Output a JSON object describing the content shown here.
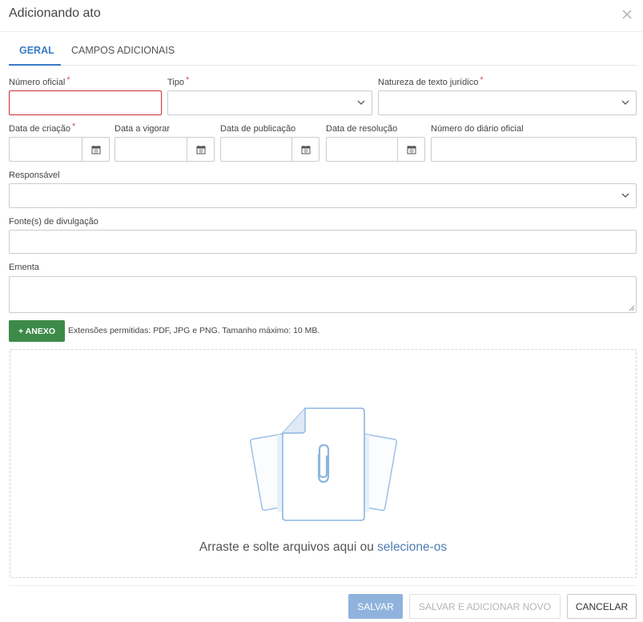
{
  "dialog": {
    "title": "Adicionando ato"
  },
  "tabs": [
    {
      "label": "GERAL"
    },
    {
      "label": "CAMPOS ADICIONAIS"
    }
  ],
  "form": {
    "numero_oficial": {
      "label": "Número oficial",
      "required_mark": "*",
      "value": ""
    },
    "tipo": {
      "label": "Tipo",
      "required_mark": "*",
      "value": ""
    },
    "natureza": {
      "label": "Natureza de texto jurídico",
      "required_mark": "*",
      "value": ""
    },
    "data_criacao": {
      "label": "Data de criação",
      "required_mark": "*",
      "value": ""
    },
    "data_vigorar": {
      "label": "Data a vigorar",
      "value": ""
    },
    "data_publicacao": {
      "label": "Data de publicação",
      "value": ""
    },
    "data_resolucao": {
      "label": "Data de resolução",
      "value": ""
    },
    "numero_diario": {
      "label": "Número do diário oficial",
      "value": ""
    },
    "responsavel": {
      "label": "Responsável",
      "value": ""
    },
    "fontes": {
      "label": "Fonte(s) de divulgação",
      "value": ""
    },
    "ementa": {
      "label": "Ementa",
      "value": ""
    }
  },
  "attachments": {
    "button_label": "+ ANEXO",
    "extensions_text": "Extensões permitidas: PDF, JPG e PNG. Tamanho máximo: 10 MB.",
    "drop_text": "Arraste e solte arquivos aqui ou",
    "select_link": "selecione-os"
  },
  "footer": {
    "save_label": "SALVAR",
    "save_new_label": "SALVAR E ADICIONAR NOVO",
    "cancel_label": "CANCELAR"
  },
  "icons": {
    "close": "close-icon",
    "dropdown": "chevron-down-icon",
    "calendar": "calendar-icon",
    "files": "documents-illustration",
    "clip": "paperclip-icon"
  },
  "colors": {
    "accent": "#3a7bc8",
    "required": "#d9534f",
    "error_border": "#c9302c",
    "anexo_button": "#3d8b48",
    "save_button": "#8fb3dc"
  }
}
